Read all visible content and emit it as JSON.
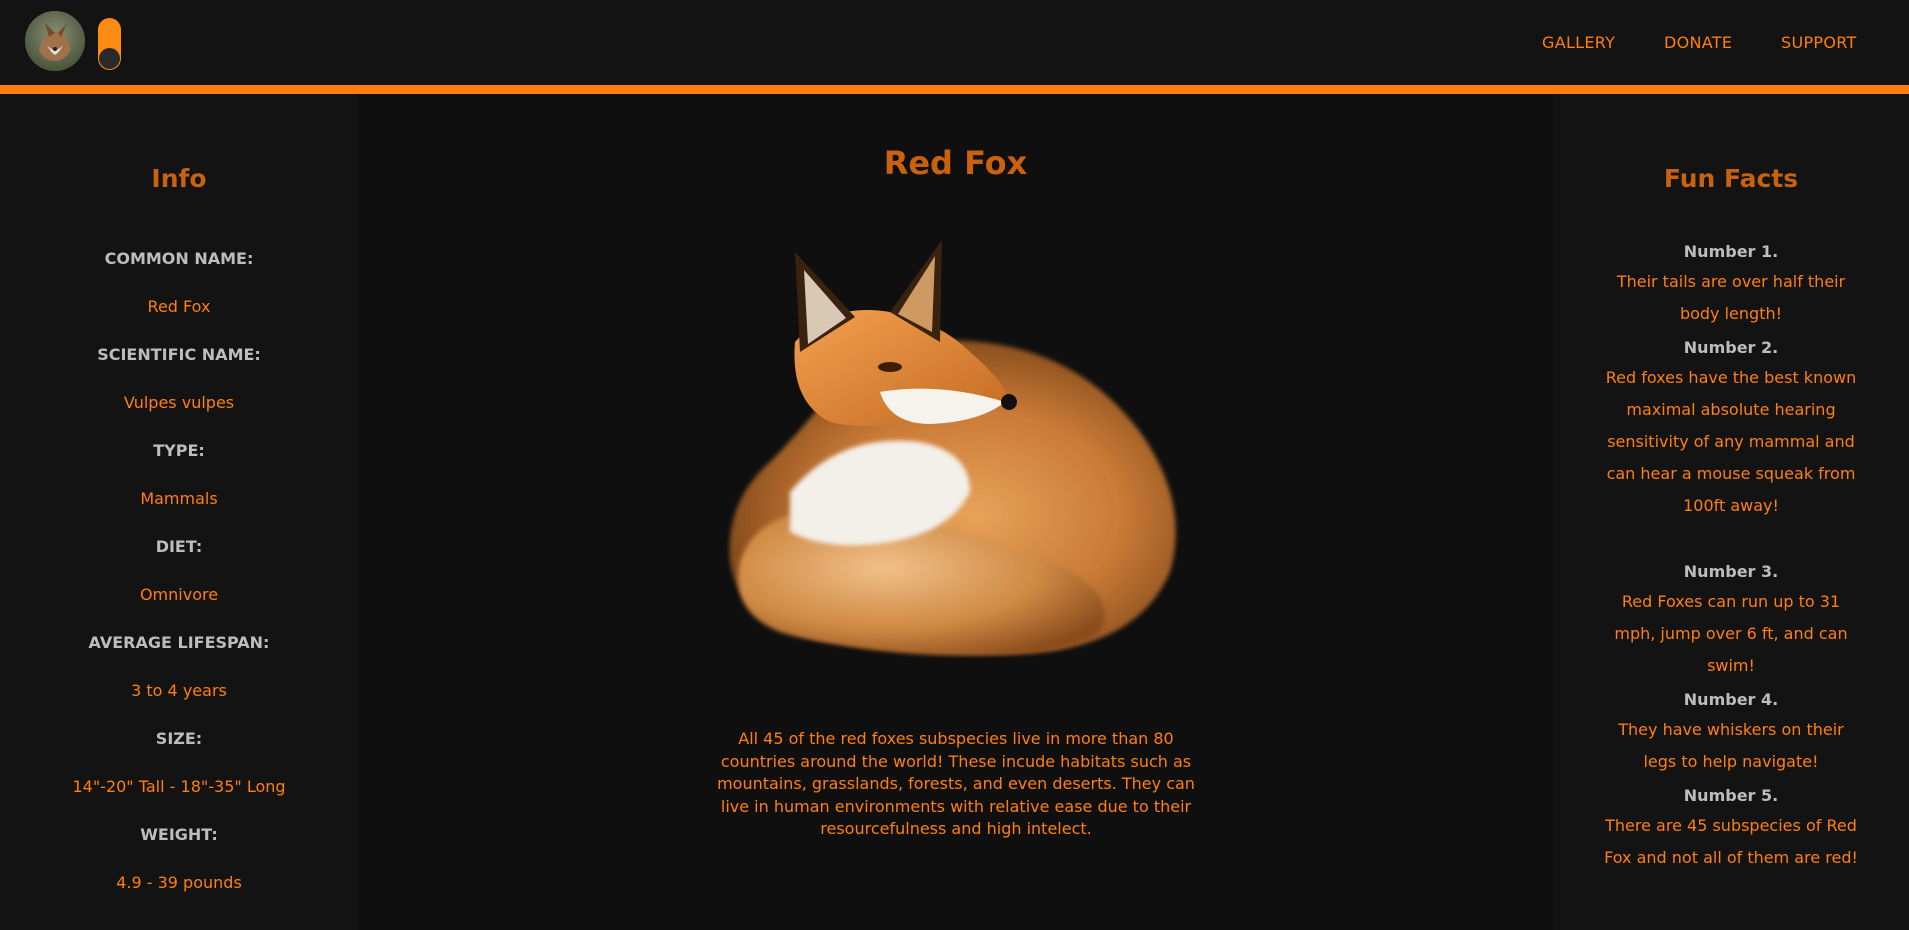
{
  "nav": {
    "gallery": "GALLERY",
    "donate": "DONATE",
    "support": "SUPPORT"
  },
  "theme": {
    "accent": "#ff7f0e",
    "title_color": "#c8620e",
    "background": "#0f0f0f",
    "panel": "#131313"
  },
  "theme_toggle": {
    "state": "on"
  },
  "info": {
    "title": "Info",
    "rows": [
      {
        "label": "COMMON NAME:",
        "value": "Red Fox"
      },
      {
        "label": "SCIENTIFIC NAME:",
        "value": "Vulpes vulpes"
      },
      {
        "label": "TYPE:",
        "value": "Mammals"
      },
      {
        "label": "DIET:",
        "value": "Omnivore"
      },
      {
        "label": "AVERAGE LIFESPAN:",
        "value": "3 to 4 years"
      },
      {
        "label": "SIZE:",
        "value": "14\"-20\" Tall - 18\"-35\" Long"
      },
      {
        "label": "WEIGHT:",
        "value": "4.9 - 39 pounds"
      }
    ]
  },
  "main": {
    "title": "Red Fox",
    "description": "All 45 of the red foxes subspecies live in more than 80 countries around the world! These incude habitats such as mountains, grasslands, forests, and even deserts. They can live in human environments with relative ease due to their resourcefulness and high intelect."
  },
  "fun_facts": {
    "title": "Fun Facts",
    "items": [
      {
        "head": "Number 1.",
        "text": "Their tails are over half their body length!"
      },
      {
        "head": "Number 2.",
        "text": "Red foxes have the best known maximal absolute hearing sensitivity of any mammal and can hear a mouse squeak from 100ft away!"
      },
      {
        "head": "Number 3.",
        "text": "Red Foxes can run up to 31 mph, jump over 6 ft, and can swim!"
      },
      {
        "head": "Number 4.",
        "text": "They have whiskers on their legs to help navigate!"
      },
      {
        "head": "Number 5.",
        "text": "There are 45 subspecies of Red Fox and not all of them are red!"
      }
    ]
  }
}
